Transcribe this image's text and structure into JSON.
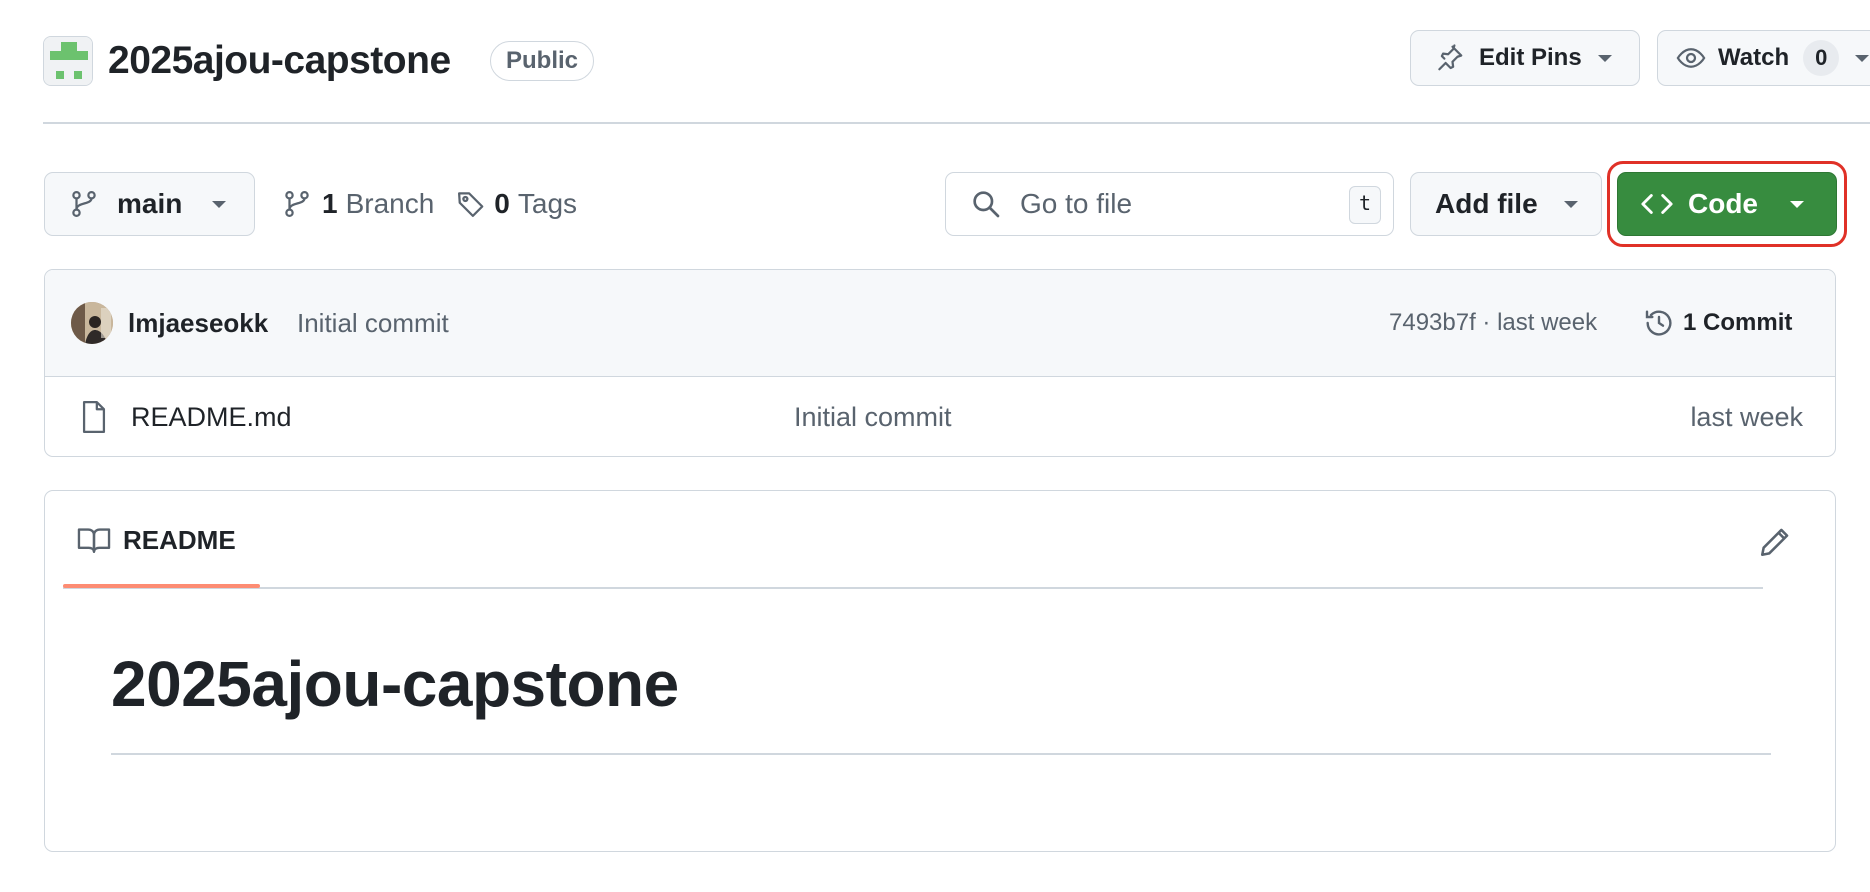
{
  "repo": {
    "name": "2025ajou-capstone",
    "visibility": "Public"
  },
  "header_actions": {
    "edit_pins_label": "Edit Pins",
    "watch_label": "Watch",
    "watch_count": "0"
  },
  "toolbar": {
    "branch_name": "main",
    "branch_count": "1",
    "branch_label": "Branch",
    "tag_count": "0",
    "tag_label": "Tags",
    "search_placeholder": "Go to file",
    "search_shortcut": "t",
    "add_file_label": "Add file",
    "code_label": "Code"
  },
  "latest_commit": {
    "author": "lmjaeseokk",
    "message": "Initial commit",
    "sha_time": "7493b7f · last week",
    "commit_count_label": "1 Commit"
  },
  "files": [
    {
      "name": "README.md",
      "message": "Initial commit",
      "date": "last week"
    }
  ],
  "readme": {
    "tab_label": "README",
    "heading": "2025ajou-capstone"
  },
  "colors": {
    "code_button": "#378c3f",
    "highlight_outline": "#e03127",
    "tab_underline": "#fd8c73",
    "repo_icon": "#6cc26e"
  },
  "icons": [
    "repo-identicon",
    "pin-icon",
    "eye-icon",
    "branch-icon",
    "tag-icon",
    "search-icon",
    "code-icon",
    "history-icon",
    "file-icon",
    "book-icon",
    "pencil-icon",
    "caret-down-icon"
  ]
}
